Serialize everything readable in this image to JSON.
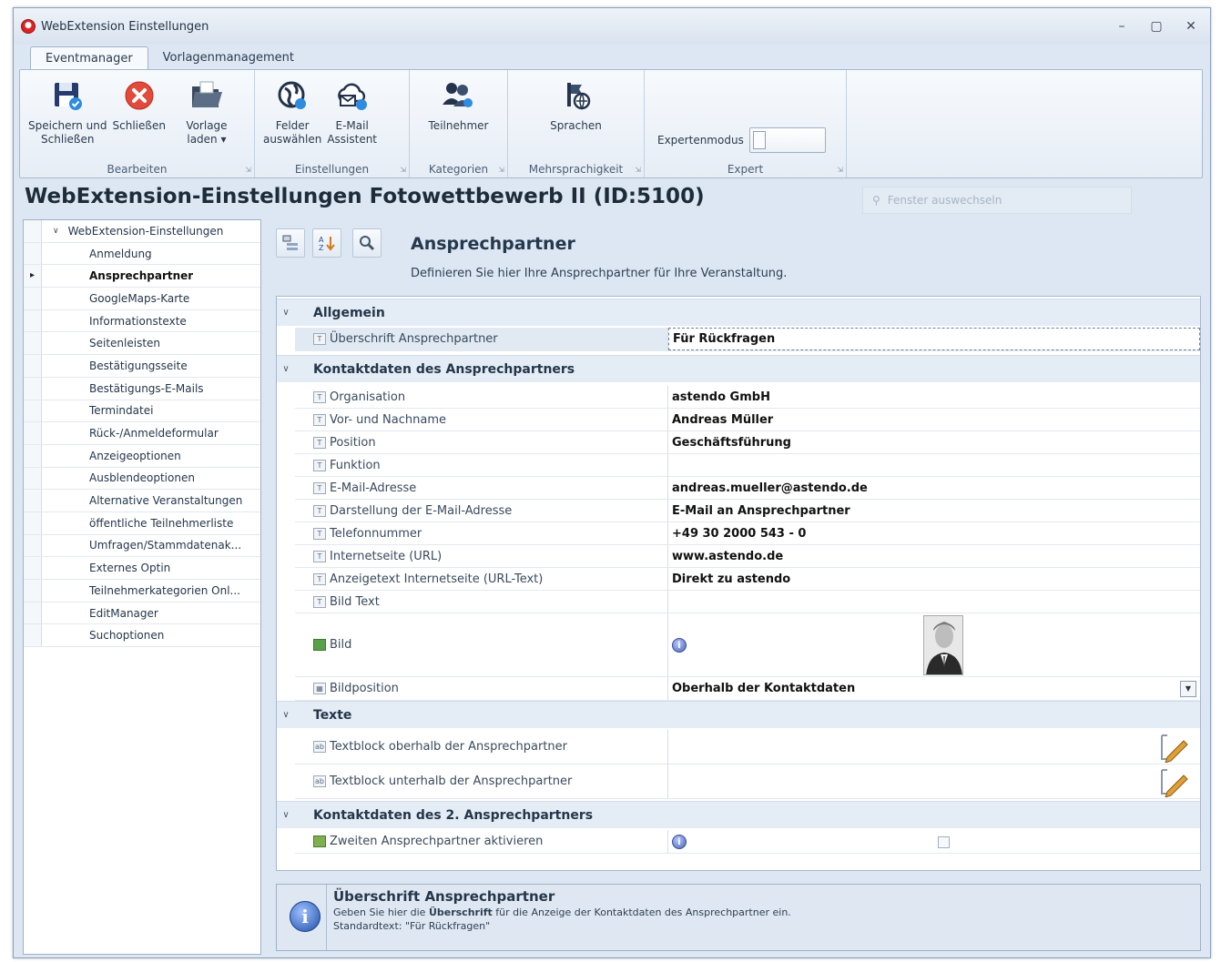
{
  "window": {
    "title": "WebExtension Einstellungen"
  },
  "ribbon": {
    "tabs": [
      "Eventmanager",
      "Vorlagenmanagement"
    ],
    "groups": {
      "bearbeiten": {
        "label": "Bearbeiten",
        "buttons": [
          "Speichern und\nSchließen",
          "Schließen",
          "Vorlage\nladen ▾"
        ]
      },
      "einstellungen": {
        "label": "Einstellungen",
        "buttons": [
          "Felder\nauswählen",
          "E-Mail\nAssistent"
        ]
      },
      "kategorien": {
        "label": "Kategorien",
        "buttons": [
          "Teilnehmer"
        ]
      },
      "mehrsprachigkeit": {
        "label": "Mehrsprachigkeit",
        "buttons": [
          "Sprachen"
        ]
      },
      "expert": {
        "label": "Expert",
        "toggle_label": "Expertenmodus"
      }
    }
  },
  "page": {
    "title": "WebExtension-Einstellungen Fotowettbewerb II (ID:5100)",
    "search_placeholder": "Fenster auswechseln"
  },
  "tree": {
    "root": "WebExtension-Einstellungen",
    "items": [
      "Anmeldung",
      "Ansprechpartner",
      "GoogleMaps-Karte",
      "Informationstexte",
      "Seitenleisten",
      "Bestätigungsseite",
      "Bestätigungs-E-Mails",
      "Termindatei",
      "Rück-/Anmeldeformular",
      "Anzeigeoptionen",
      "Ausblendeoptionen",
      "Alternative Veranstaltungen",
      "öffentliche Teilnehmerliste",
      "Umfragen/Stammdatenak...",
      "Externes Optin",
      "Teilnehmerkategorien Onl...",
      "EditManager",
      "Suchoptionen"
    ],
    "selected_index": 1
  },
  "section": {
    "title": "Ansprechpartner",
    "description": "Definieren Sie hier Ihre Ansprechpartner für Ihre Veranstaltung."
  },
  "grid": {
    "categories": [
      {
        "label": "Allgemein",
        "rows": [
          {
            "name": "Überschrift Ansprechpartner",
            "value": "Für Rückfragen"
          }
        ]
      },
      {
        "label": "Kontaktdaten des Ansprechpartners",
        "rows": [
          {
            "name": "Organisation",
            "value": "astendo GmbH"
          },
          {
            "name": "Vor- und Nachname",
            "value": "Andreas Müller"
          },
          {
            "name": "Position",
            "value": "Geschäftsführung"
          },
          {
            "name": "Funktion",
            "value": ""
          },
          {
            "name": "E-Mail-Adresse",
            "value": "andreas.mueller@astendo.de"
          },
          {
            "name": "Darstellung der E-Mail-Adresse",
            "value": "E-Mail an Ansprechpartner"
          },
          {
            "name": "Telefonnummer",
            "value": "+49 30 2000 543 - 0"
          },
          {
            "name": "Internetseite (URL)",
            "value": "www.astendo.de"
          },
          {
            "name": "Anzeigetext Internetseite (URL-Text)",
            "value": "Direkt zu astendo"
          },
          {
            "name": "Bild Text",
            "value": ""
          },
          {
            "name": "Bild",
            "value": ""
          },
          {
            "name": "Bildposition",
            "value": "Oberhalb der Kontaktdaten"
          }
        ]
      },
      {
        "label": "Texte",
        "rows": [
          {
            "name": "Textblock oberhalb der Ansprechpartner",
            "value": ""
          },
          {
            "name": "Textblock unterhalb der Ansprechpartner",
            "value": ""
          }
        ]
      },
      {
        "label": "Kontaktdaten des 2. Ansprechpartners",
        "rows": [
          {
            "name": "Zweiten Ansprechpartner aktivieren",
            "value": ""
          }
        ]
      }
    ]
  },
  "info": {
    "title": "Überschrift Ansprechpartner",
    "line1_pre": "Geben Sie hier die ",
    "line1_bold": "Überschrift",
    "line1_post": " für die Anzeige der Kontaktdaten des Ansprechpartner ein.",
    "line2": "Standardtext: \"Für Rückfragen\""
  },
  "colors": {
    "window_bg": "#dde7f3",
    "category_bg": "#e4ecf5",
    "accent_blue": "#1f4fa8",
    "close_red": "#e24a3b"
  }
}
